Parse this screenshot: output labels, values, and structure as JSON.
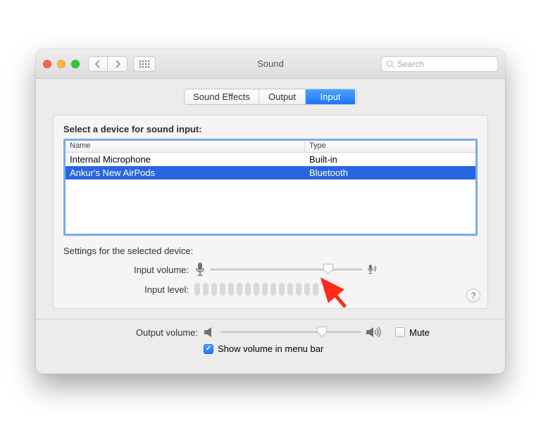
{
  "window": {
    "title": "Sound"
  },
  "search": {
    "placeholder": "Search"
  },
  "tabs": {
    "sound_effects": "Sound Effects",
    "output": "Output",
    "input": "Input"
  },
  "input_panel": {
    "heading": "Select a device for sound input:",
    "columns": {
      "name": "Name",
      "type": "Type"
    },
    "devices": [
      {
        "name": "Internal Microphone",
        "type": "Built-in"
      },
      {
        "name": "Ankur's New AirPods",
        "type": "Bluetooth"
      }
    ],
    "selected_index": 1,
    "settings_heading": "Settings for the selected device:",
    "input_volume_label": "Input volume:",
    "input_volume_percent": 78,
    "input_level_label": "Input level:",
    "input_level_cells": 15,
    "help_label": "?"
  },
  "output": {
    "label": "Output volume:",
    "volume_percent": 72,
    "mute_label": "Mute",
    "mute_checked": false,
    "show_menu_label": "Show volume in menu bar",
    "show_menu_checked": true
  }
}
